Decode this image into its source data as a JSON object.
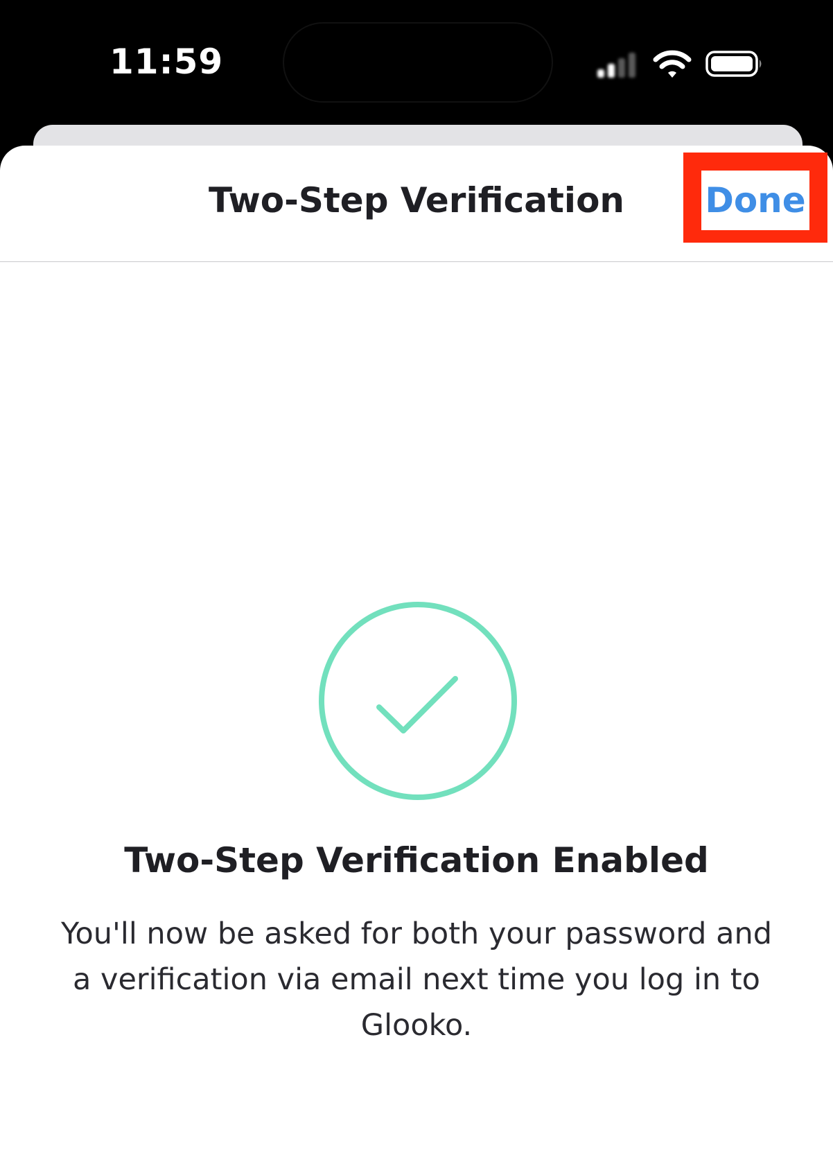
{
  "status_bar": {
    "time": "11:59",
    "icons": [
      "signal-icon",
      "wifi-icon",
      "battery-icon"
    ]
  },
  "header": {
    "title": "Two-Step Verification",
    "done_label": "Done"
  },
  "content": {
    "icon": "checkmark-circle-icon",
    "title": "Two-Step Verification Enabled",
    "description": "You'll now be asked for both your password and a verification via email next time you log in to Glooko."
  },
  "colors": {
    "accent_blue": "#3f8ee6",
    "success_green": "#72e0bd",
    "highlight_red": "#ff2a0c",
    "text_dark": "#1f1f24"
  }
}
